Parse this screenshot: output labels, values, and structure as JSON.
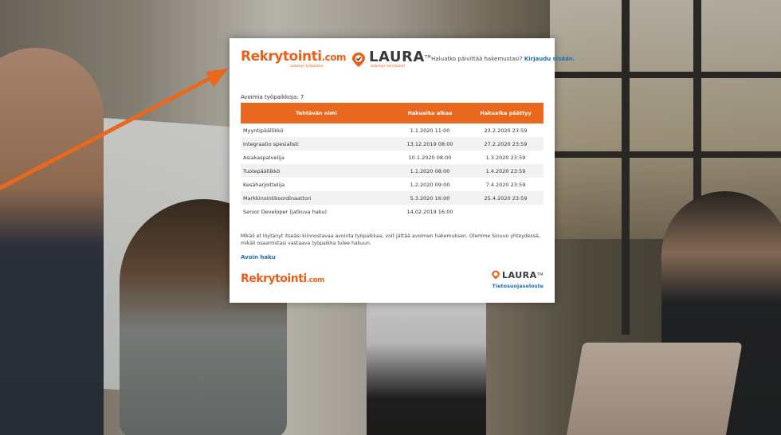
{
  "login": {
    "question": "Haluatko päivittää hakemustasi?",
    "link": "Kirjaudu sisään."
  },
  "logo": {
    "rekry": "Rekrytointi",
    "dotcom": ".com",
    "rekry_tag": "aidompi työpaikka",
    "laura": "LAURA",
    "tm": "TM",
    "laura_tag": "aidompi rekrytointi"
  },
  "count_label": "Avoimia työpaikkoja: 7",
  "table": {
    "headers": [
      "Tehtävän nimi",
      "Hakuaika alkaa",
      "Hakuaika päättyy"
    ],
    "rows": [
      [
        "Myyntipäällikkö",
        "1.1.2020 11:00",
        "23.2.2020 23:59"
      ],
      [
        "Integraatio spesialisti",
        "13.12.2019 08:00",
        "27.2.2020 23:59"
      ],
      [
        "Asiakaspalvelija",
        "10.1.2020 08:00",
        "1.3.2020 23:59"
      ],
      [
        "Tuotepäällikkö",
        "1.1.2020 08:00",
        "1.4.2020 23:59"
      ],
      [
        "Kesäharjoittelija",
        "1.2.2020 09:00",
        "7.4.2020 23:59"
      ],
      [
        "Markkinointikoordinaattori",
        "5.3.2020 16:00",
        "25.4.2020 23:59"
      ],
      [
        "Senior Developer (jatkuva haku)",
        "14.02.2019 16:00",
        ""
      ]
    ]
  },
  "note": "Mikäli et löytänyt itseäsi kiinnostavaa avointa työpaikkaa, voit jättää avoimen hakemuksen. Olemme Sinuun yhteydessä, mikäli osaamistasi vastaava työpaikka tulee hakuun.",
  "open_application": "Avoin haku",
  "privacy": "Tietosuojaseloste",
  "colors": {
    "accent": "#e8691e",
    "link": "#1a6fb0"
  }
}
